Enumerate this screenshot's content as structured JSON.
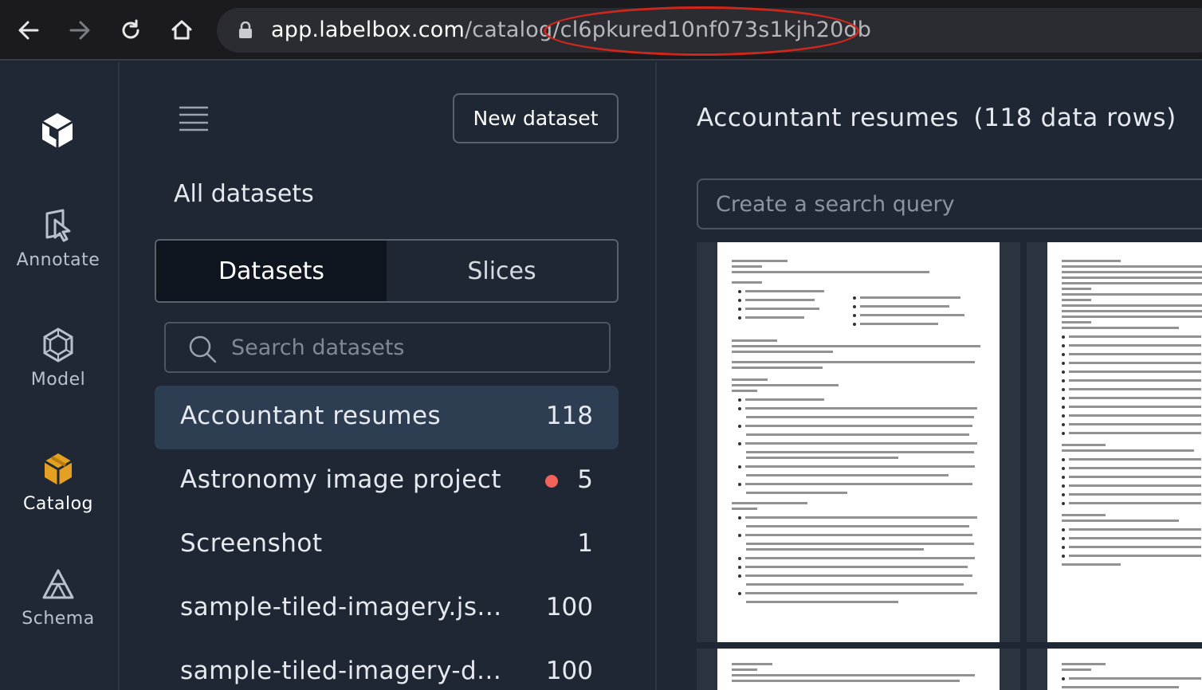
{
  "browser": {
    "url_host": "app.labelbox.com",
    "url_path": "/catalog/",
    "url_id": "cl6pkured10nf073s1kjh20db"
  },
  "nav": {
    "items": [
      {
        "label": "Annotate",
        "icon": "annotate-icon"
      },
      {
        "label": "Model",
        "icon": "model-icon"
      },
      {
        "label": "Catalog",
        "icon": "catalog-icon"
      },
      {
        "label": "Schema",
        "icon": "schema-icon"
      }
    ],
    "active": "Catalog"
  },
  "datasets_panel": {
    "new_button": "New dataset",
    "title": "All datasets",
    "tabs": [
      "Datasets",
      "Slices"
    ],
    "active_tab": "Datasets",
    "search_placeholder": "Search datasets",
    "items": [
      {
        "name": "Accountant resumes",
        "count": "118",
        "active": true
      },
      {
        "name": "Astronomy image project",
        "count": "5",
        "status_color": "#f0625a"
      },
      {
        "name": "Screenshot",
        "count": "1"
      },
      {
        "name": "sample-tiled-imagery.js...",
        "count": "100"
      },
      {
        "name": "sample-tiled-imagery-d...",
        "count": "100"
      }
    ]
  },
  "detail": {
    "title": "Accountant resumes",
    "row_count": "(118 data rows)",
    "search_placeholder": "Create a search query"
  },
  "colors": {
    "accent_catalog": "#e3a021",
    "annotation_ellipse": "#d0271c",
    "active_row": "#2d3d52"
  }
}
